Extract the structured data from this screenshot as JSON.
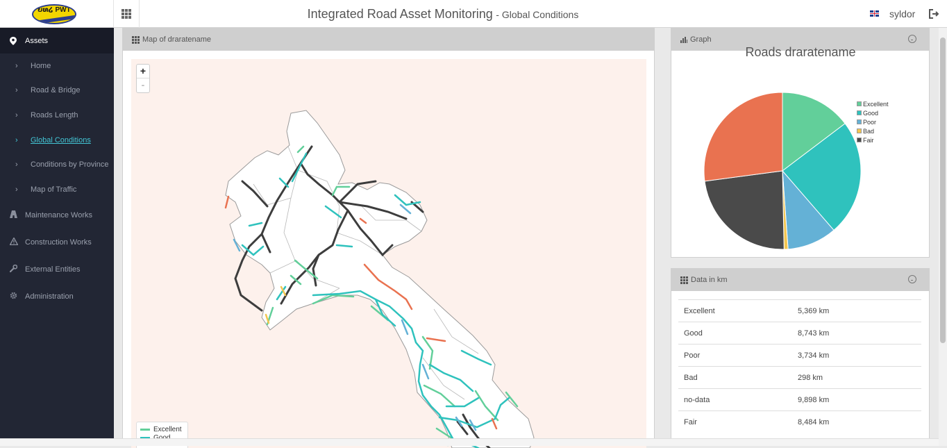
{
  "header": {
    "logo_text": "ບທ໒ PWT",
    "title": "Integrated Road Asset Monitoring",
    "subtitle": "- Global Conditions",
    "username": "syldor"
  },
  "sidebar": {
    "section_label": "Assets",
    "subitems": [
      {
        "label": "Home",
        "active": false
      },
      {
        "label": "Road & Bridge",
        "active": false
      },
      {
        "label": "Roads Length",
        "active": false
      },
      {
        "label": "Global Conditions",
        "active": true
      },
      {
        "label": "Conditions by Province",
        "active": false
      },
      {
        "label": "Map of Traffic",
        "active": false
      }
    ],
    "main_items": [
      {
        "label": "Maintenance Works",
        "icon": "road-icon"
      },
      {
        "label": "Construction Works",
        "icon": "warning-icon"
      },
      {
        "label": "External Entities",
        "icon": "wrench-icon"
      },
      {
        "label": "Administration",
        "icon": "gear-icon"
      }
    ]
  },
  "map_panel": {
    "title": "Map of draratename",
    "zoom_in": "+",
    "zoom_out": "-",
    "legend": [
      {
        "label": "Excellent",
        "color": "#62cf9a"
      },
      {
        "label": "Good",
        "color": "#2fc2bd"
      }
    ]
  },
  "graph_panel": {
    "header": "Graph",
    "chart_data": {
      "type": "pie",
      "title": "Roads draratename",
      "labels": [
        "Excellent",
        "Good",
        "Poor",
        "Bad",
        "Fair",
        "no-data"
      ],
      "values": [
        5369,
        8743,
        3734,
        298,
        8484,
        9898
      ],
      "colors": [
        "#62cf9a",
        "#2fc2bd",
        "#64b1d6",
        "#f3c650",
        "#4a4a4a",
        "#e97250"
      ],
      "legend": [
        "Excellent",
        "Good",
        "Poor",
        "Bad",
        "Fair"
      ],
      "legend_position": "right"
    }
  },
  "data_panel": {
    "title": "Data in km",
    "rows": [
      {
        "label": "Excellent",
        "value": "5,369 km"
      },
      {
        "label": "Good",
        "value": "8,743 km"
      },
      {
        "label": "Poor",
        "value": "3,734 km"
      },
      {
        "label": "Bad",
        "value": "298 km"
      },
      {
        "label": "no-data",
        "value": "9,898 km"
      },
      {
        "label": "Fair",
        "value": "8,484 km"
      }
    ]
  }
}
